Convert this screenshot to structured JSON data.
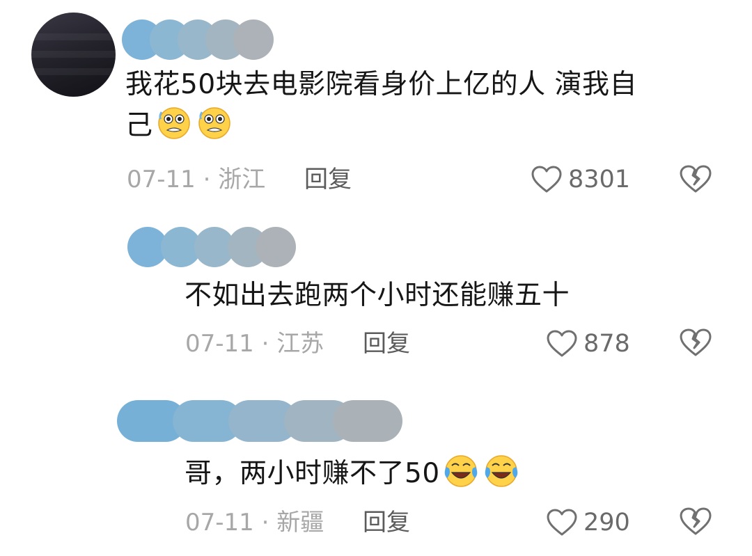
{
  "comments": [
    {
      "text": "我花50块去电影院看身价上亿的人 演我自",
      "text_line2": "己",
      "emoji": "sweat-pleading-face-icon",
      "date_location": "07-11 · 浙江",
      "reply_label": "回复",
      "likes": "8301"
    },
    {
      "text": "不如出去跑两个小时还能赚五十",
      "date_location": "07-11 · 江苏",
      "reply_label": "回复",
      "likes": "878"
    },
    {
      "text": "哥，两小时赚不了50",
      "emoji": "crying-laughing-face-icon",
      "date_location": "07-11 · 新疆",
      "reply_label": "回复",
      "likes": "290"
    }
  ],
  "colors": {
    "blur_palette": [
      "#7eb4d8",
      "#8fb9d5",
      "#9ab8cc",
      "#a6b6c2",
      "#adb4ba"
    ],
    "meta_text": "#a7a7a7",
    "icon_stroke": "#707070"
  }
}
